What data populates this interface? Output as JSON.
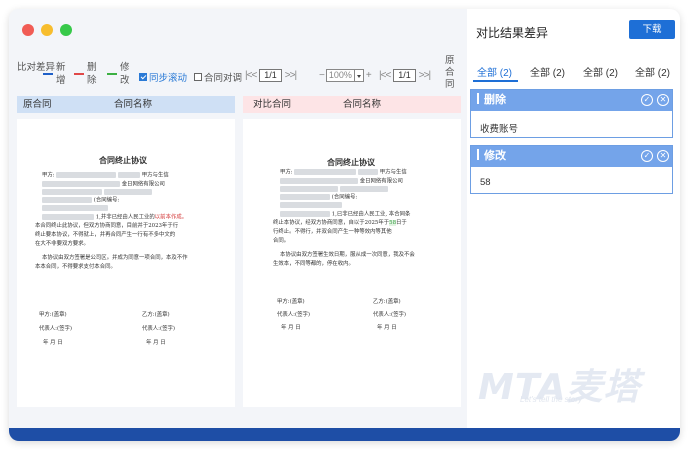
{
  "toolbar": {
    "compare_diff": [
      "比对",
      "差异"
    ],
    "legend_add": [
      "新",
      "增"
    ],
    "legend_delete": [
      "删",
      "除"
    ],
    "legend_modify": [
      "修",
      "改"
    ],
    "sync_scroll": "同步滚动",
    "contract_align": "合同对调",
    "page_left": "1/1",
    "zoom": "100%",
    "page_right": "1/1",
    "original_contract": [
      "原",
      "合",
      "同"
    ],
    "colors": {
      "add": "#1e5fc8",
      "delete": "#e04848",
      "modify": "#3cb043"
    }
  },
  "left_pane": {
    "header_label": "原合同",
    "header_name": "合同名称",
    "doc": {
      "title": "合同终止协议",
      "party_a": "甲方:",
      "line1_tail": "甲方与生信",
      "line2_tail": "金日网络有限公司",
      "line3": "(合同编号:",
      "line4_mid": "1,并非已经由人民工业的",
      "line4_red": "以前本作成。",
      "line5": "本合同终止此协议，但双方协商同意，目前并于2023年于行",
      "line6": "终止要本协议，不得就上，并再合同产生一行有不多中文的",
      "line7": "在大不非要双方要求。",
      "line8": "本协议由双方签署是公司区。并成为同意一项合同，本及不作",
      "line9": "本本合同，不得要求支付本合同。",
      "sign_a": "甲方:(盖章)",
      "sign_b": "乙方:(盖章)",
      "rep_a": "代表人:(签字)",
      "rep_b": "代表人:(签字)",
      "date_a": "年 月 日",
      "date_b": "年 月 日"
    }
  },
  "right_pane": {
    "header_label": "对比合同",
    "header_name": "合同名称",
    "doc": {
      "title": "合同终止协议",
      "party_a": "甲方:",
      "line1_tail": "甲方与生信",
      "line2_tail": "金日网络有限公司",
      "line3": "(合同编号:",
      "line4_mid": "1,已非已经由人民工业, 本合同条",
      "line5": "终止本协议，经双方协商同意，自以于2025年于",
      "line5_green": "58",
      "line5_tail": "日于",
      "line6": "行终止。不得行，并双合同产生一种等效内等其他",
      "line7": "合同。",
      "line8": "本协议由双方签署生效日期，服从成一次同意，我及不会",
      "line9": "生效本，不同等都的，停在收内。",
      "sign_a": "甲方:(盖章)",
      "sign_b": "乙方:(盖章)",
      "rep_a": "代表人:(签字)",
      "rep_b": "代表人:(签字)",
      "date_a": "年 月 日",
      "date_b": "年 月 日"
    }
  },
  "result_panel": {
    "title": "对比结果差异",
    "download": "下载",
    "tabs": [
      "全部 (2)",
      "全部 (2)",
      "全部 (2)",
      "全部 (2)"
    ],
    "delete_card": {
      "title": "删除",
      "content": "收费账号"
    },
    "modify_card": {
      "title": "修改",
      "content": "58"
    }
  },
  "watermark": {
    "logo": "MTA麦塔",
    "slogan": "Let's tell the story"
  }
}
